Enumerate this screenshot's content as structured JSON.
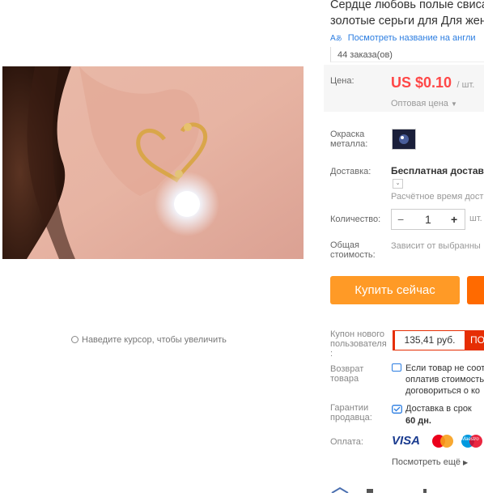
{
  "zoom_hint": "Наведите курсор, чтобы увеличить",
  "product": {
    "title_line1": "Сердце любовь полые свисаю",
    "title_line2": "золотые серьги для Для женщ",
    "translate_link": "Посмотреть название на англи",
    "orders": "44 заказа(ов)"
  },
  "price": {
    "label": "Цена:",
    "value": "US $0.10",
    "unit": "/ шт.",
    "wholesale": "Оптовая цена"
  },
  "color": {
    "label_line1": "Окраска",
    "label_line2": "металла:"
  },
  "shipping": {
    "label": "Доставка:",
    "value": "Бесплатная доставка",
    "estimate": "Расчётное время дост"
  },
  "quantity": {
    "label": "Количество:",
    "value": "1",
    "unit": "шт.",
    "minus": "−",
    "plus": "+"
  },
  "total": {
    "label_line1": "Общая",
    "label_line2": "стоимость:",
    "value": "Зависит от выбранны"
  },
  "buttons": {
    "buy_now": "Купить сейчас"
  },
  "coupon": {
    "label_line1": "Купон нового",
    "label_line2": "пользователя",
    "label_line3": ":",
    "value": "135,41 руб.",
    "get": "ПО"
  },
  "returns": {
    "label_line1": "Возврат",
    "label_line2": "товара",
    "text_line1": "Если товар не соот",
    "text_line2": "оплатив стоимость",
    "text_line3": "договориться о ко"
  },
  "guarantee": {
    "label_line1": "Гарантии",
    "label_line2": "продавца:",
    "text_line1": "Доставка в срок",
    "text_line2": "60 дн."
  },
  "payment": {
    "label": "Оплата:",
    "visa": "VISA",
    "maestro": "Maestro",
    "see_more": "Посмотреть ещё"
  },
  "colors": {
    "accent": "#ff4747",
    "buy": "#ff9a26",
    "cart": "#ff6a00",
    "link": "#2b7de1"
  }
}
